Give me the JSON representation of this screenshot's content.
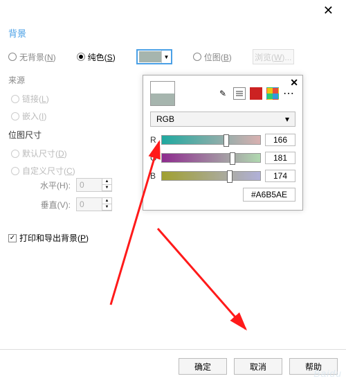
{
  "titlebar": {
    "close": "✕"
  },
  "section": {
    "background": "背景"
  },
  "radios": {
    "no_bg": "无背景(",
    "no_bg_key": "N",
    "no_bg_close": ")",
    "solid": "纯色(",
    "solid_key": "S",
    "solid_close": ")",
    "bitmap": "位图(",
    "bitmap_key": "B",
    "bitmap_close": ")"
  },
  "browse": {
    "label": "浏览(",
    "key": "W",
    "close": ")..."
  },
  "source": {
    "title": "来源",
    "link": "链接(",
    "link_key": "L",
    "link_close": ")",
    "embed": "嵌入(",
    "embed_key": "I",
    "embed_close": ")"
  },
  "bitmap_size": {
    "title": "位图尺寸",
    "default": "默认尺寸(",
    "default_key": "D",
    "default_close": ")",
    "custom": "自定义尺寸(",
    "custom_key": "C",
    "custom_close": ")",
    "h": "水平(H):",
    "v": "垂直(V):",
    "h_val": "0",
    "v_val": "0"
  },
  "print_export": {
    "label": "打印和导出背景(",
    "key": "P",
    "close": ")"
  },
  "buttons": {
    "ok": "确定",
    "cancel": "取消",
    "help": "帮助"
  },
  "picker": {
    "close": "✕",
    "mode": "RGB",
    "dropdown_arrow": "▾",
    "eyedropper": "✎",
    "dots": "∙∙∙",
    "r_label": "R",
    "g_label": "G",
    "b_label": "B",
    "r": "166",
    "g": "181",
    "b": "174",
    "hex": "#A6B5AE"
  },
  "watermark": "Baidu"
}
